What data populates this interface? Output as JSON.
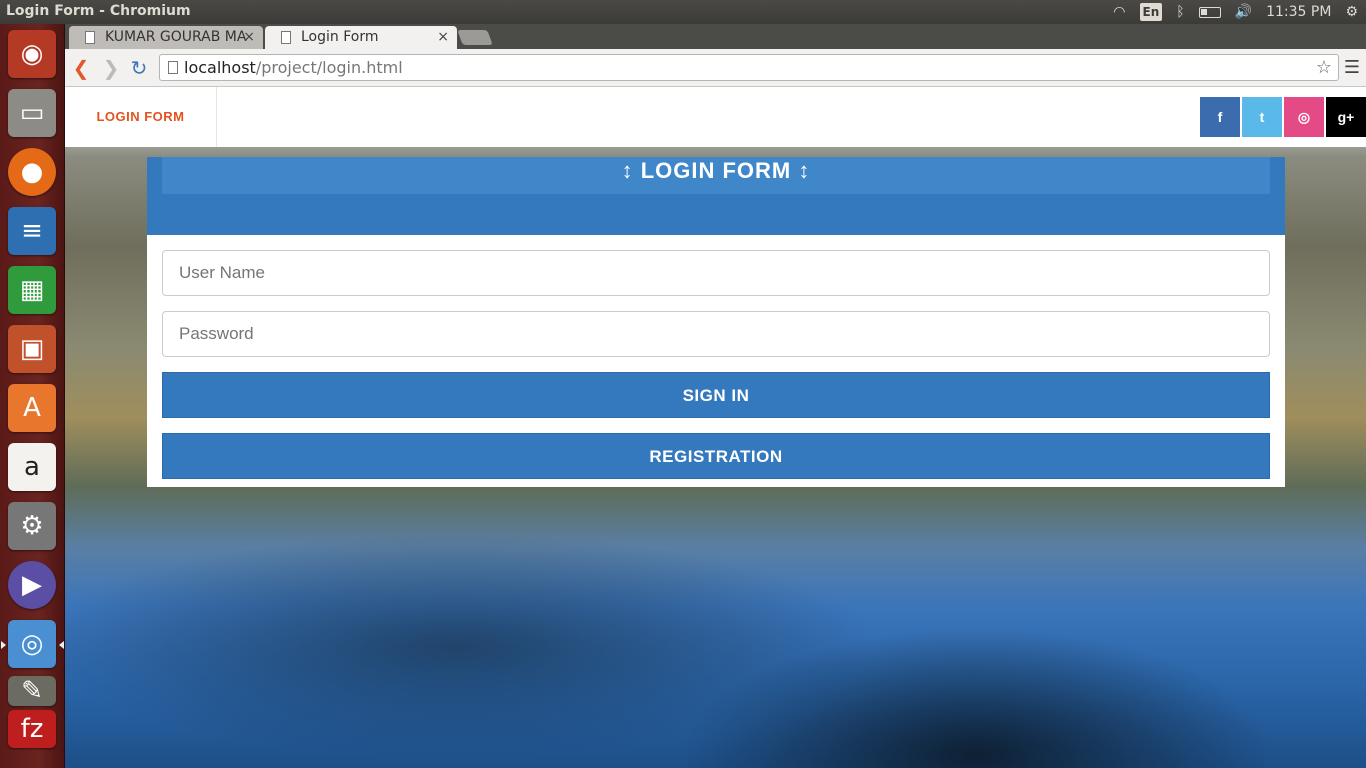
{
  "window": {
    "title": "Login Form - Chromium"
  },
  "tray": {
    "language": "En",
    "clock": "11:35 PM"
  },
  "browser": {
    "tabs": [
      {
        "label": "KUMAR GOURAB MA",
        "active": false
      },
      {
        "label": "Login Form",
        "active": true
      }
    ],
    "url": {
      "host": "localhost",
      "path": "/project/login.html"
    }
  },
  "site": {
    "brand": "LOGIN FORM",
    "social": [
      {
        "name": "facebook",
        "glyph": "f",
        "color": "#3b6cae"
      },
      {
        "name": "twitter",
        "glyph": "t",
        "color": "#5bb9ea"
      },
      {
        "name": "dribbble",
        "glyph": "◎",
        "color": "#e44a85"
      },
      {
        "name": "google-plus",
        "glyph": "g+",
        "color": "#000000"
      }
    ]
  },
  "login": {
    "title": "↕ LOGIN FORM ↕",
    "username_placeholder": "User Name",
    "password_placeholder": "Password",
    "signin_label": "SIGN IN",
    "register_label": "REGISTRATION"
  },
  "launcher": [
    "ubuntu-dash-icon",
    "files-icon",
    "firefox-icon",
    "writer-icon",
    "calc-icon",
    "impress-icon",
    "software-center-icon",
    "amazon-icon",
    "system-settings-icon",
    "media-player-icon",
    "chromium-icon",
    "gimp-icon",
    "filezilla-icon"
  ]
}
